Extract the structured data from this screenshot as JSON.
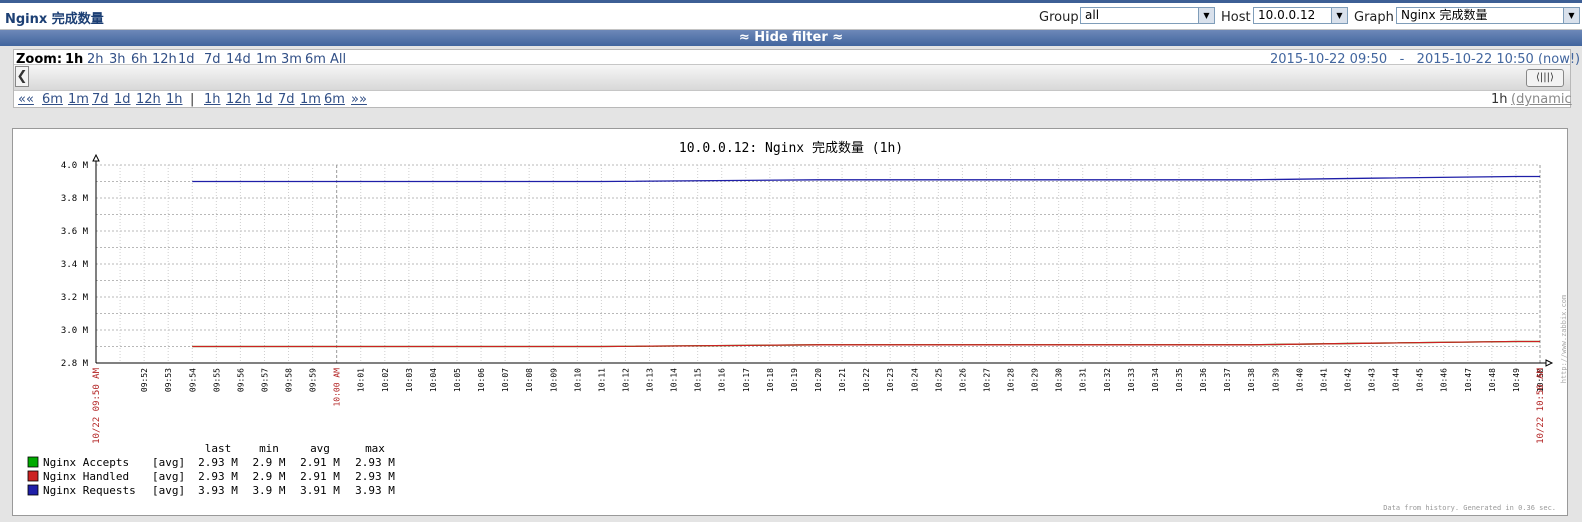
{
  "header": {
    "title": "Nginx 完成数量",
    "group_label": "Group",
    "group_value": "all",
    "host_label": "Host",
    "host_value": "10.0.0.12",
    "graph_label": "Graph",
    "graph_value": "Nginx 完成数量"
  },
  "filter_toggle": {
    "label": "≈ Hide filter ≈"
  },
  "timebar": {
    "zoom_label": "Zoom:",
    "zoom_options": [
      "1h",
      "2h",
      "3h",
      "6h",
      "12h",
      "1d",
      "7d",
      "14d",
      "1m",
      "3m",
      "6m",
      "All"
    ],
    "active_zoom": "1h",
    "period_from": "2015-10-22 09:50",
    "period_sep": "-",
    "period_to": "2015-10-22 10:50 (now!)",
    "back_start": "««",
    "back_options": [
      "6m",
      "1m",
      "7d",
      "1d",
      "12h",
      "1h"
    ],
    "separator": "|",
    "forward_options": [
      "1h",
      "12h",
      "1d",
      "7d",
      "1m",
      "6m"
    ],
    "forward_end": "»»",
    "period_value": "1h",
    "dynamic_label": "(dynamic"
  },
  "chart_data": {
    "type": "line",
    "title": "10.0.0.12: Nginx 完成数量 (1h)",
    "ylim": [
      2.8,
      4.0
    ],
    "y_unit": "M",
    "y_ticks": [
      "2.8 M",
      "3.0 M",
      "3.2 M",
      "3.4 M",
      "3.6 M",
      "3.8 M",
      "4.0 M"
    ],
    "x_start_label": "10/22 09:50 AM",
    "x_end_label": "10/22 10:50 AM",
    "x_labels": [
      "09:52",
      "09:53",
      "09:54",
      "09:55",
      "09:56",
      "09:57",
      "09:58",
      "09:59",
      "10:00 AM",
      "10:01",
      "10:02",
      "10:03",
      "10:04",
      "10:05",
      "10:06",
      "10:07",
      "10:08",
      "10:09",
      "10:10",
      "10:11",
      "10:12",
      "10:13",
      "10:14",
      "10:15",
      "10:16",
      "10:17",
      "10:18",
      "10:19",
      "10:20",
      "10:21",
      "10:22",
      "10:23",
      "10:24",
      "10:25",
      "10:26",
      "10:27",
      "10:28",
      "10:29",
      "10:30",
      "10:31",
      "10:32",
      "10:33",
      "10:34",
      "10:35",
      "10:36",
      "10:37",
      "10:38",
      "10:39",
      "10:40",
      "10:41",
      "10:42",
      "10:43",
      "10:44",
      "10:45",
      "10:46",
      "10:47",
      "10:48",
      "10:49",
      "10:50"
    ],
    "x": [
      4,
      12,
      21,
      30,
      39,
      48,
      53,
      59,
      60
    ],
    "series": [
      {
        "name": "Nginx Accepts",
        "color": "#00aa00",
        "values": [
          2.9,
          2.9,
          2.9,
          2.91,
          2.91,
          2.91,
          2.92,
          2.93,
          2.93
        ]
      },
      {
        "name": "Nginx Handled",
        "color": "#cc2222",
        "values": [
          2.9,
          2.9,
          2.9,
          2.91,
          2.91,
          2.91,
          2.92,
          2.93,
          2.93
        ]
      },
      {
        "name": "Nginx Requests",
        "color": "#1f1fa8",
        "values": [
          3.9,
          3.9,
          3.9,
          3.91,
          3.91,
          3.91,
          3.92,
          3.93,
          3.93
        ]
      }
    ],
    "legend_headers": [
      "last",
      "min",
      "avg",
      "max"
    ],
    "legend_rows": [
      {
        "name": "Nginx Accepts",
        "func": "[avg]",
        "last": "2.93 M",
        "min": "2.9 M",
        "avg": "2.91 M",
        "max": "2.93 M"
      },
      {
        "name": "Nginx Handled",
        "func": "[avg]",
        "last": "2.93 M",
        "min": "2.9 M",
        "avg": "2.91 M",
        "max": "2.93 M"
      },
      {
        "name": "Nginx Requests",
        "func": "[avg]",
        "last": "3.93 M",
        "min": "3.9 M",
        "avg": "3.91 M",
        "max": "3.93 M"
      }
    ],
    "footer_note": "Data from history. Generated in 0.36 sec.",
    "watermark": "http://www.zabbix.com",
    "grid": true
  }
}
